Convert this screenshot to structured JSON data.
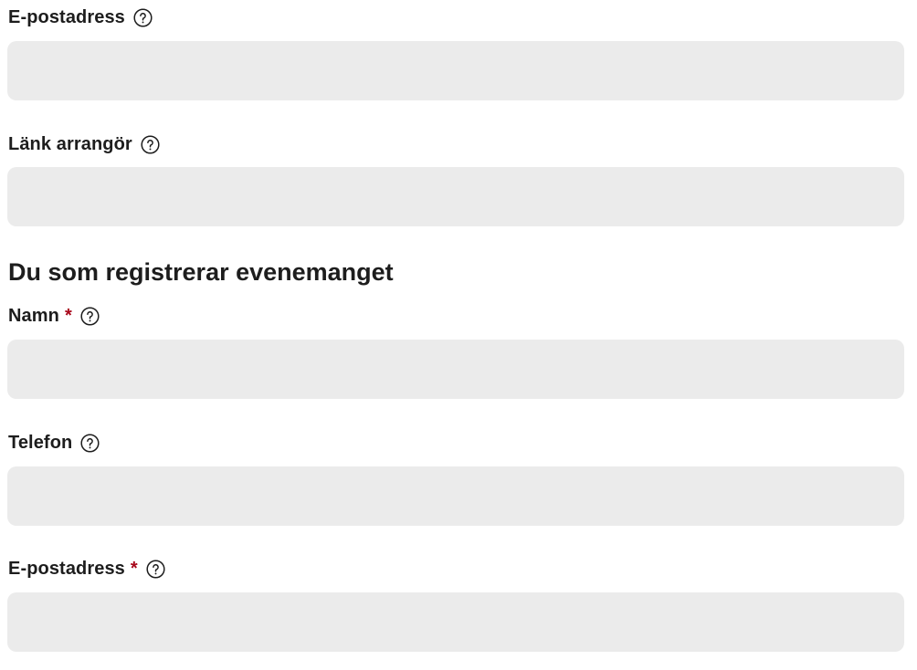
{
  "organizer": {
    "email": {
      "label": "E-postadress",
      "required": false,
      "value": "",
      "placeholder": ""
    },
    "link": {
      "label": "Länk arrangör",
      "required": false,
      "value": "",
      "placeholder": ""
    }
  },
  "registrant_section": {
    "heading": "Du som registrerar evenemanget",
    "name": {
      "label": "Namn",
      "required_marker": "*",
      "value": "",
      "placeholder": ""
    },
    "phone": {
      "label": "Telefon",
      "value": "",
      "placeholder": ""
    },
    "email": {
      "label": "E-postadress",
      "required_marker": "*",
      "value": "",
      "placeholder": ""
    }
  },
  "icons": {
    "help": "help-circle-icon"
  },
  "colors": {
    "input_background": "#ebebeb",
    "required_marker": "#a8071a",
    "text": "#1d1d1d"
  }
}
